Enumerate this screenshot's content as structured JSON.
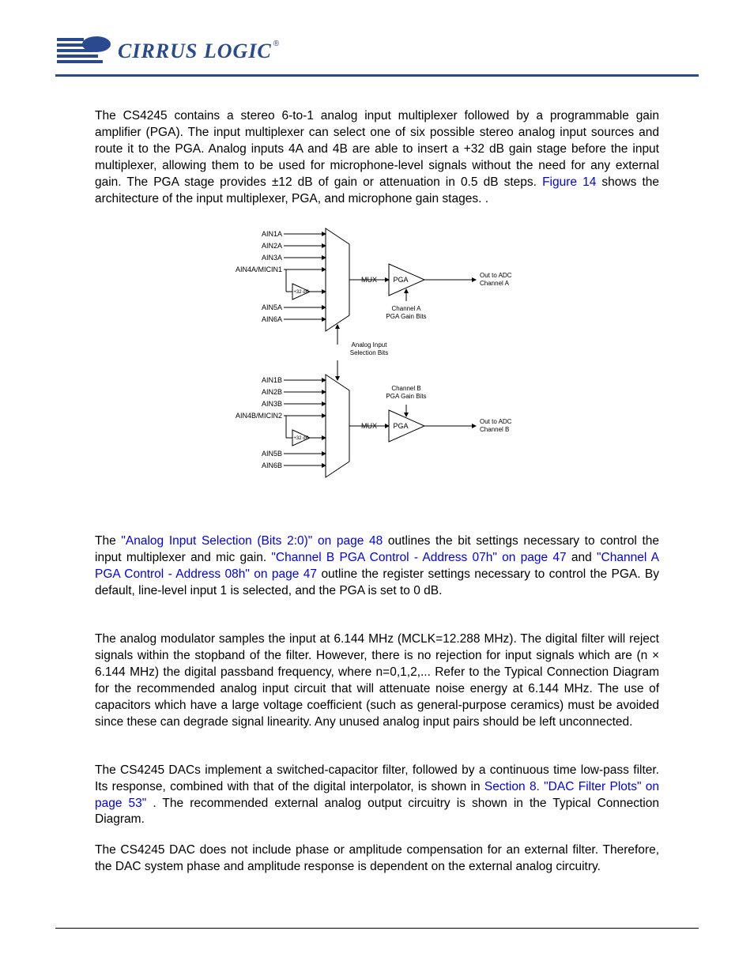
{
  "brand": {
    "name": "CIRRUS LOGIC",
    "reg": "®"
  },
  "para1": {
    "t1": "The CS4245 contains a stereo 6-to-1 analog input multiplexer followed by a programmable gain amplifier (PGA). The input multiplexer can select one of six possible stereo analog input sources and route it to the PGA. Analog inputs 4A and 4B are able to insert a +32 dB gain stage before the input multiplexer, allowing them to be used for microphone-level signals without the need for any external gain. The PGA stage provides ±12 dB of gain or attenuation in 0.5 dB steps. ",
    "link1": "Figure 14",
    "t2": " shows the architecture of the input multiplexer, PGA, and microphone gain stages. ."
  },
  "para2": {
    "t1": "The ",
    "link1": "\"Analog Input Selection (Bits 2:0)\" on page 48",
    "t2": " outlines the bit settings necessary to control the input multiplexer and mic gain. ",
    "link2": "\"Channel B PGA Control - Address 07h\" on page 47",
    "t3": " and ",
    "link3": "\"Channel A PGA Control - Address 08h\" on page 47",
    "t4": " outline the register settings necessary to control the PGA. By default, line-level input 1 is selected, and the PGA is set to 0 dB."
  },
  "para3": "The analog modulator samples the input at 6.144 MHz (MCLK=12.288 MHz). The digital filter will reject signals within the stopband of the filter. However, there is no rejection for input signals which are (n × 6.144 MHz) the digital passband frequency, where n=0,1,2,... Refer to the Typical Connection Diagram for the recommended analog input circuit that will attenuate noise energy at 6.144 MHz. The use of capacitors which have a large voltage coefficient (such as general-purpose ceramics) must be avoided since these can degrade signal linearity. Any unused analog input pairs should be left unconnected.",
  "para4": {
    "t1": "The CS4245 DACs implement a switched-capacitor filter, followed by a continuous time low-pass filter. Its response, combined with that of the digital interpolator, is shown in ",
    "link1": "Section 8. \"DAC Filter Plots\" on page 53\"",
    "t2": ". The recommended external analog output circuitry is shown in the Typical Connection Diagram."
  },
  "para5": "The CS4245 DAC does not include phase or amplitude compensation for an external filter. Therefore, the DAC system phase and amplitude response is dependent on the external analog circuitry.",
  "diagram": {
    "a": {
      "in1": "AIN1A",
      "in2": "AIN2A",
      "in3": "AIN3A",
      "in4": "AIN4A/MICIN1",
      "in5": "AIN5A",
      "in6": "AIN6A",
      "gain": "+32 dB",
      "mux": "MUX",
      "pga": "PGA",
      "out1": "Out to ADC",
      "out2": "Channel A",
      "pga_bits1": "Channel A",
      "pga_bits2": "PGA Gain Bits"
    },
    "sel1": "Analog Input",
    "sel2": "Selection Bits",
    "b": {
      "in1": "AIN1B",
      "in2": "AIN2B",
      "in3": "AIN3B",
      "in4": "AIN4B/MICIN2",
      "in5": "AIN5B",
      "in6": "AIN6B",
      "gain": "+32 dB",
      "mux": "MUX",
      "pga": "PGA",
      "out1": "Out to ADC",
      "out2": "Channel B",
      "pga_bits1": "Channel B",
      "pga_bits2": "PGA Gain Bits"
    }
  }
}
